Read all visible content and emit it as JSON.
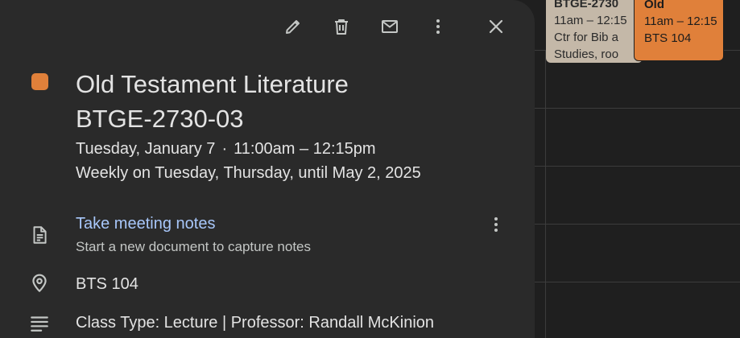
{
  "colors": {
    "event_swatch": "#e0803a",
    "panel_bg": "#2a2a2a",
    "link": "#a8c7fa"
  },
  "toolbar": {
    "edit_icon": "pencil-icon",
    "delete_icon": "trash-icon",
    "email_icon": "mail-icon",
    "more_icon": "more-vert-icon",
    "close_icon": "close-icon"
  },
  "event": {
    "title_line1": "Old Testament Literature",
    "title_line2": "BTGE-2730-03",
    "date": "Tuesday, January 7",
    "separator": "·",
    "time": "11:00am – 12:15pm",
    "recurrence": "Weekly on Tuesday, Thursday, until May 2, 2025"
  },
  "notes": {
    "link_label": "Take meeting notes",
    "subtitle": "Start a new document to capture notes"
  },
  "location": "BTS 104",
  "description": "Class Type: Lecture | Professor: Randall McKinion",
  "calendar_events": [
    {
      "title": "BTGE-2730",
      "time": "11am – 12:15",
      "line3": "Ctr for Bib a",
      "line4": "Studies, roo"
    },
    {
      "title": "Old",
      "time": "11am – 12:15",
      "line3": "BTS 104"
    }
  ]
}
